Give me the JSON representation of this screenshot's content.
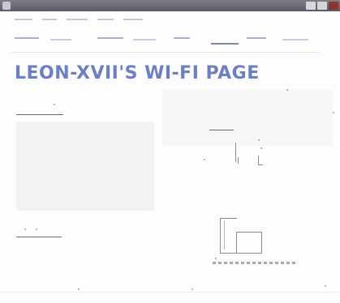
{
  "window": {
    "title_text": ""
  },
  "header": {
    "page_title": "LEON-XVII'S WI-FI PAGE"
  },
  "colors": {
    "title_color": "#6c7fc2",
    "nav_color": "#6b78a6",
    "titlebar_color": "#5a5a66"
  }
}
